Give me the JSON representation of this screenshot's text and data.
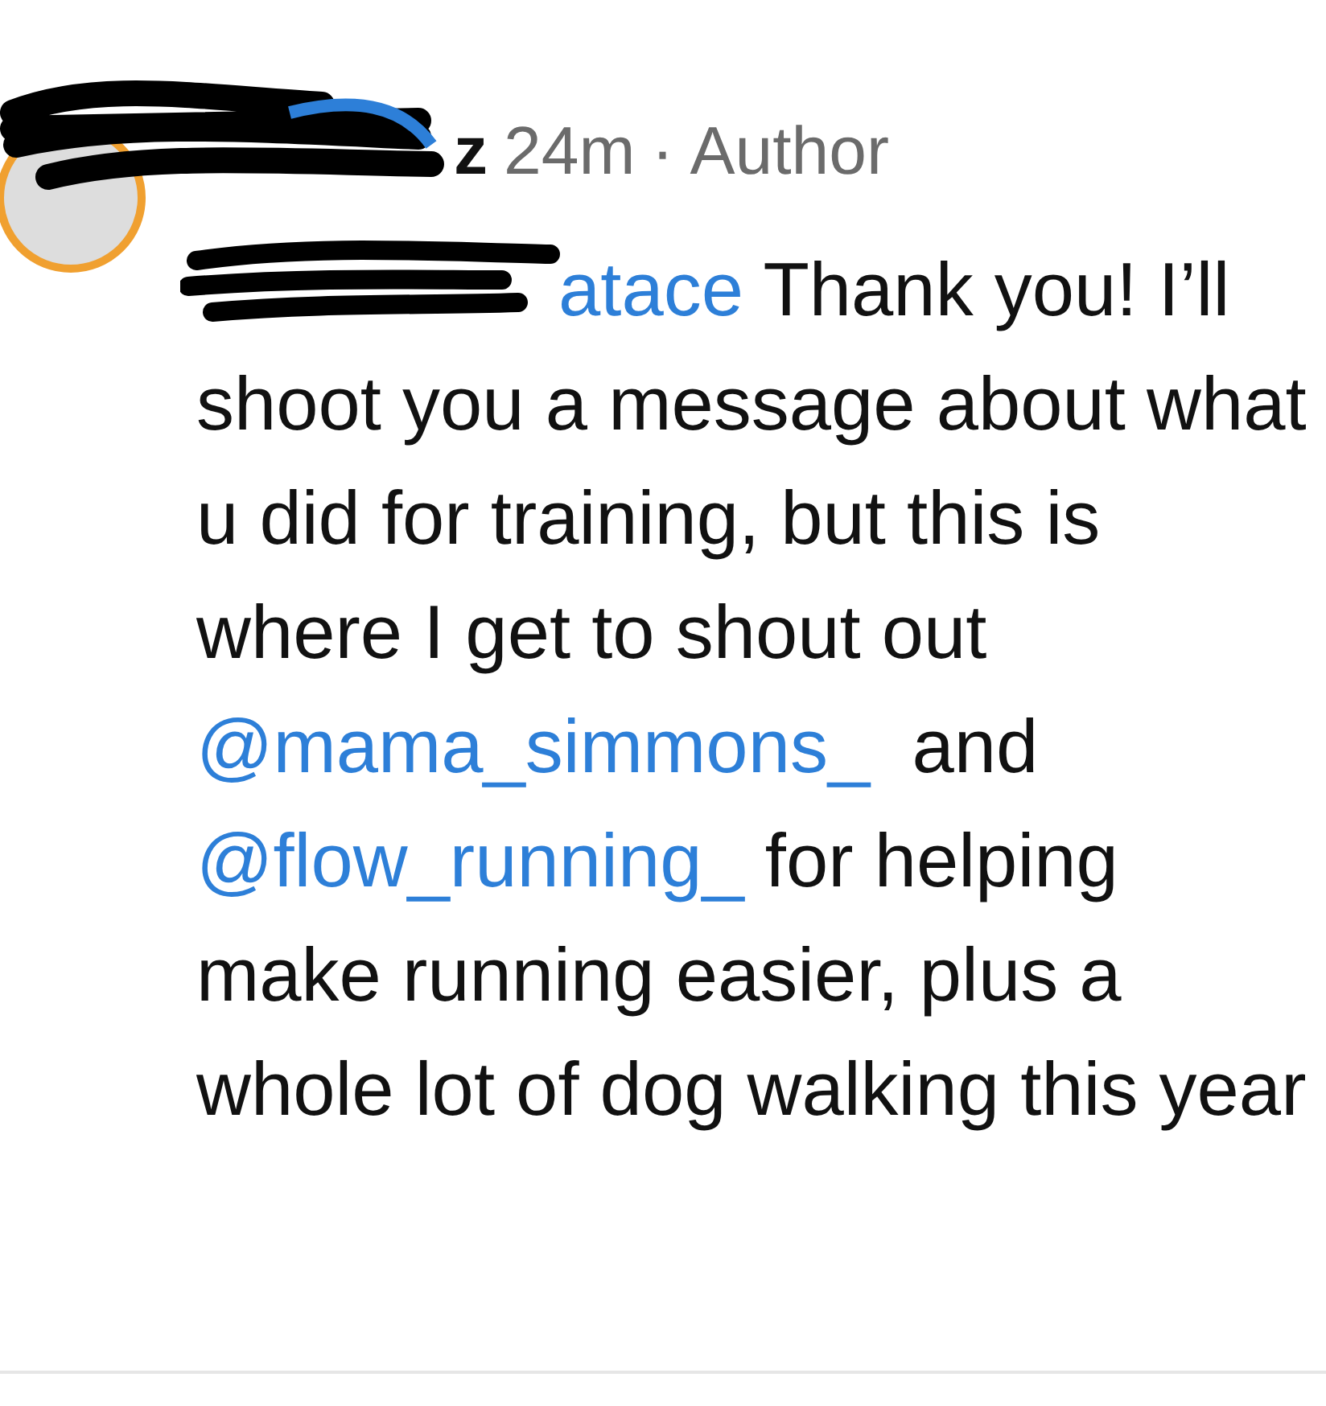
{
  "comment": {
    "author": "z",
    "time": "24m",
    "separator": "·",
    "badge": "Author",
    "body": [
      {
        "kind": "mention",
        "text": "atace"
      },
      {
        "kind": "text",
        "text": " Thank you! I’ll shoot you a message about what u did for training, but this is where I get to shout out "
      },
      {
        "kind": "mention",
        "text": "@mama_simmons_"
      },
      {
        "kind": "text",
        "text": "  and "
      },
      {
        "kind": "mention",
        "text": "@flow_running_"
      },
      {
        "kind": "text",
        "text": " for helping make running easier, plus a whole lot of dog walking this year"
      }
    ]
  }
}
